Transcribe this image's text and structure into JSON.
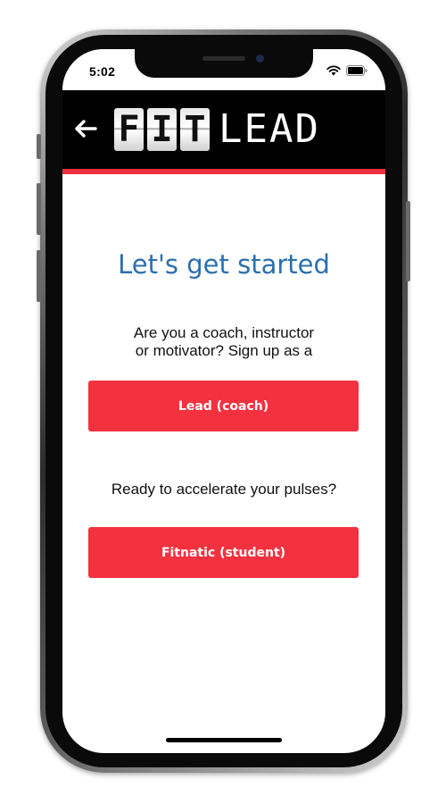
{
  "status_bar": {
    "time": "5:02"
  },
  "app": {
    "logo_tiles": [
      "F",
      "I",
      "T"
    ],
    "logo_word": "LEAD"
  },
  "main": {
    "title": "Let's get started",
    "coach_prompt_line1": "Are you a coach, instructor",
    "coach_prompt_line2": "or motivator? Sign up as a",
    "lead_button_label": "Lead (coach)",
    "student_prompt": "Ready to accelerate your pulses?",
    "fitnatic_button_label": "Fitnatic (student)"
  },
  "colors": {
    "appbar": "#000000",
    "accent_red": "#f4313f",
    "title_blue": "#2b6fb0"
  },
  "icons": {
    "back": "back-arrow-icon",
    "wifi": "wifi-icon",
    "battery": "battery-icon"
  }
}
